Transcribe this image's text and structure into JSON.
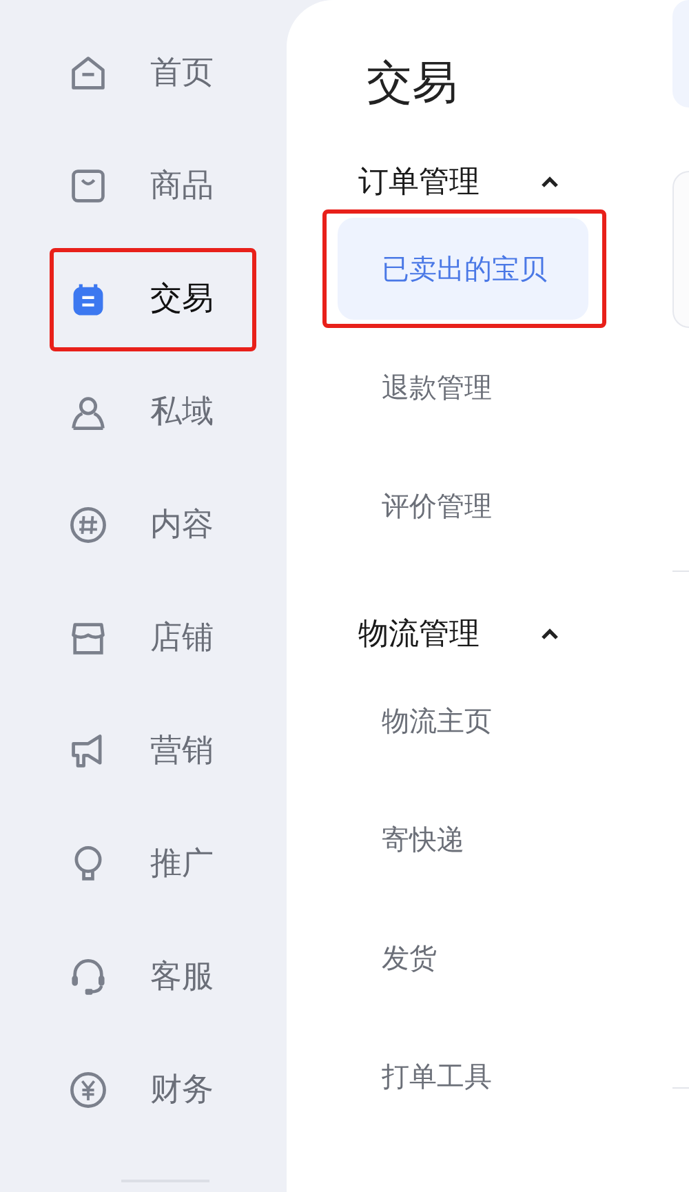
{
  "sidebar": {
    "items": [
      {
        "label": "首页",
        "selected": false,
        "annotated": false
      },
      {
        "label": "商品",
        "selected": false,
        "annotated": false
      },
      {
        "label": "交易",
        "selected": true,
        "annotated": true
      },
      {
        "label": "私域",
        "selected": false,
        "annotated": false
      },
      {
        "label": "内容",
        "selected": false,
        "annotated": false
      },
      {
        "label": "店铺",
        "selected": false,
        "annotated": false
      },
      {
        "label": "营销",
        "selected": false,
        "annotated": false
      },
      {
        "label": "推广",
        "selected": false,
        "annotated": false
      },
      {
        "label": "客服",
        "selected": false,
        "annotated": false
      },
      {
        "label": "财务",
        "selected": false,
        "annotated": false
      }
    ]
  },
  "submenu": {
    "title": "交易",
    "sections": [
      {
        "label": "订单管理",
        "expanded": true,
        "items": [
          {
            "label": "已卖出的宝贝",
            "selected": true,
            "annotated": true
          },
          {
            "label": "退款管理",
            "selected": false,
            "annotated": false
          },
          {
            "label": "评价管理",
            "selected": false,
            "annotated": false
          }
        ]
      },
      {
        "label": "物流管理",
        "expanded": true,
        "items": [
          {
            "label": "物流主页",
            "selected": false,
            "annotated": false
          },
          {
            "label": "寄快递",
            "selected": false,
            "annotated": false
          },
          {
            "label": "发货",
            "selected": false,
            "annotated": false
          },
          {
            "label": "打单工具",
            "selected": false,
            "annotated": false
          }
        ]
      }
    ]
  }
}
